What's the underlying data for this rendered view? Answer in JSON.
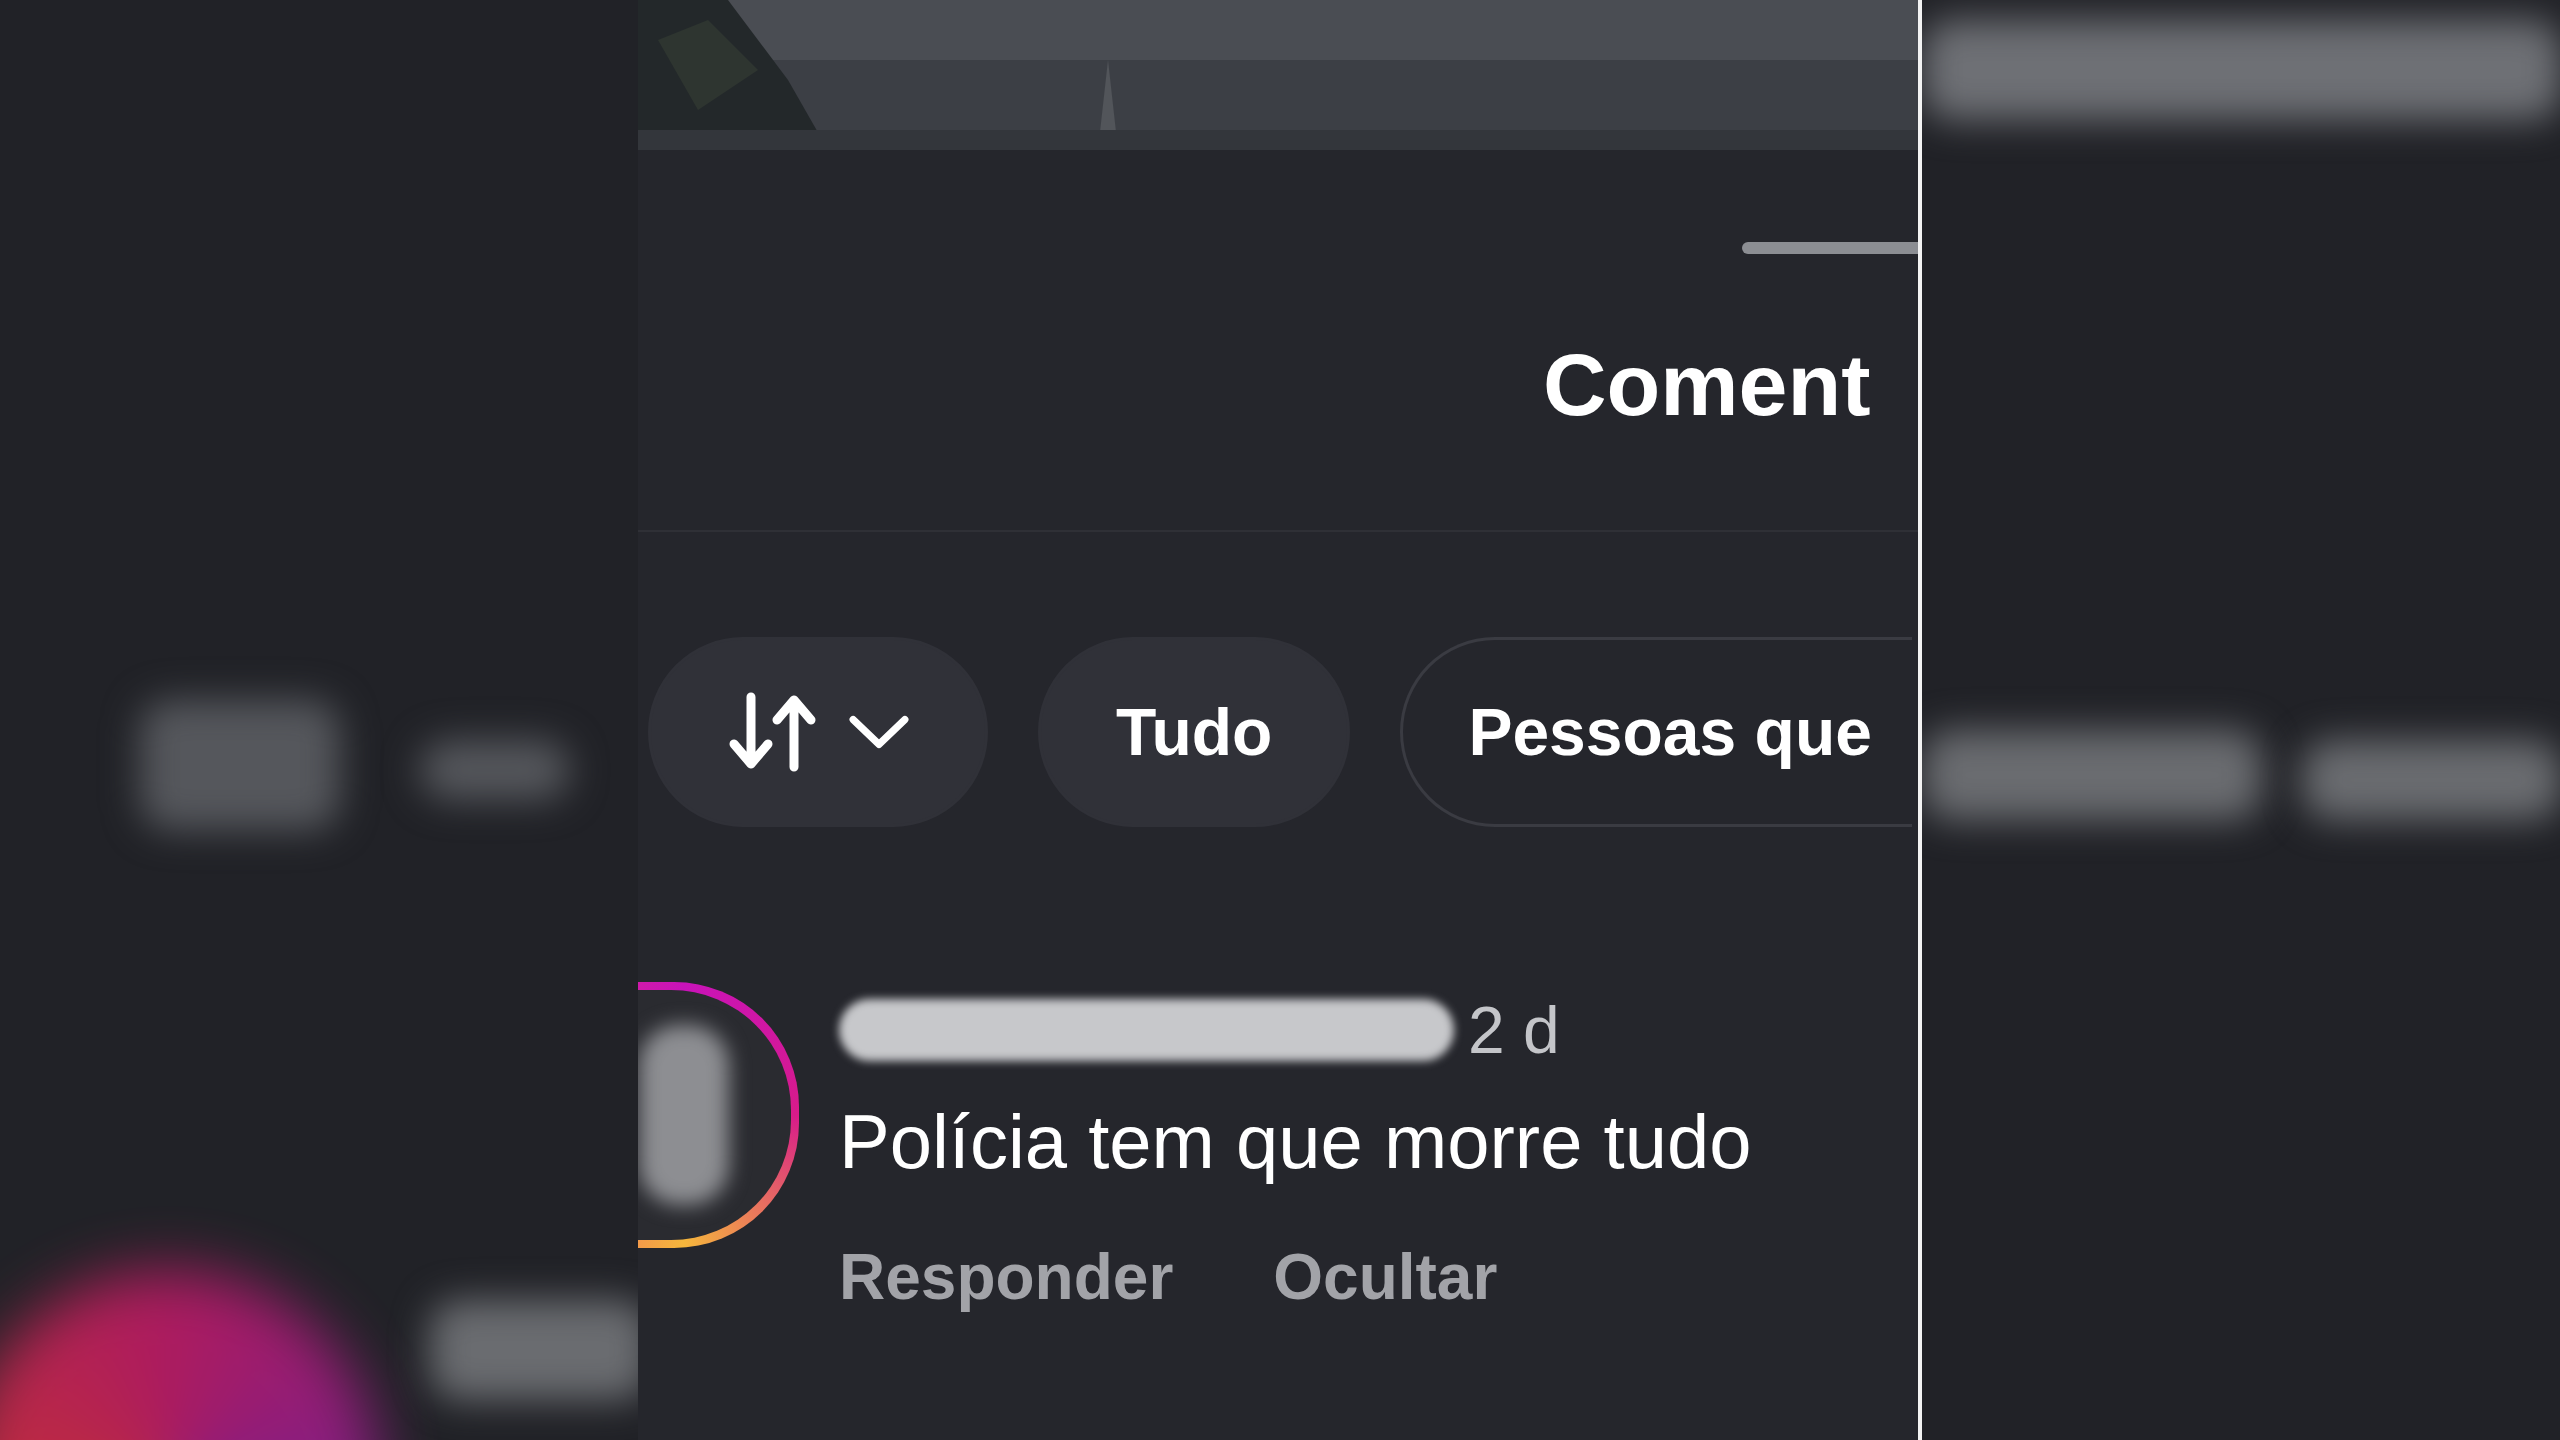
{
  "sheet": {
    "title": "Coment",
    "filters": [
      {
        "kind": "sort"
      },
      {
        "kind": "label",
        "label": "Tudo",
        "selected": true
      },
      {
        "kind": "label",
        "label": "Pessoas que",
        "selected": false
      }
    ],
    "comments": [
      {
        "time": "2 d",
        "text": "Polícia tem que morre tudo",
        "actions": [
          "Responder",
          "Ocultar"
        ]
      }
    ]
  }
}
